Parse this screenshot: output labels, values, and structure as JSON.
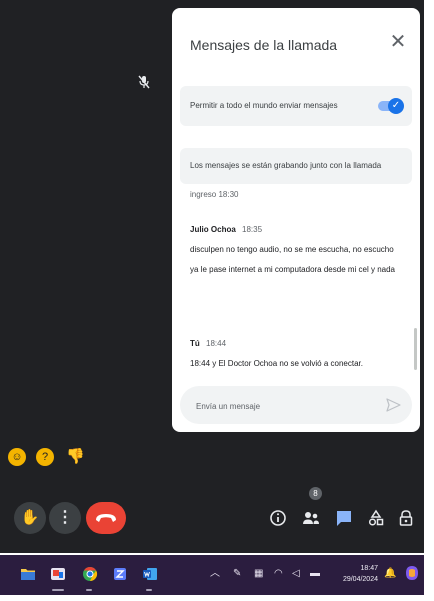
{
  "chat_panel": {
    "title": "Mensajes de la llamada",
    "close_icon": "close-icon",
    "allow_messages_label": "Permitir a todo el mundo enviar mensajes",
    "allow_messages_enabled": true,
    "recording_notice": "Los mensajes se están grabando junto con la llamada",
    "clipped_line": "ingreso 18:30",
    "messages": [
      {
        "sender": "Julio Ochoa",
        "time": "18:35",
        "lines": [
          "disculpen no tengo audio, no se me escucha, no escucho",
          "ya le pase internet a mi computadora desde mi cel y nada"
        ]
      },
      {
        "sender": "Tú",
        "time": "18:44",
        "lines": [
          "18:44 y El Doctor Ochoa no se volvió a conectar."
        ]
      }
    ],
    "composer": {
      "placeholder": "Envía un mensaje",
      "value": ""
    }
  },
  "reactions": [
    "smiling-face-icon",
    "thinking-face-icon",
    "thumbs-down-icon"
  ],
  "controls": {
    "people_count": "8",
    "active_panel": "chat"
  },
  "taskbar": {
    "apps": [
      "file-explorer-icon",
      "meet-app-icon",
      "chrome-icon",
      "app-icon",
      "word-icon"
    ],
    "time": "18:47",
    "date": "29/04/2024"
  },
  "colors": {
    "meet_background": "#202124",
    "accent_blue": "#1a73e8",
    "end_call_red": "#ea4335",
    "taskbar": "#2b1d3f"
  }
}
